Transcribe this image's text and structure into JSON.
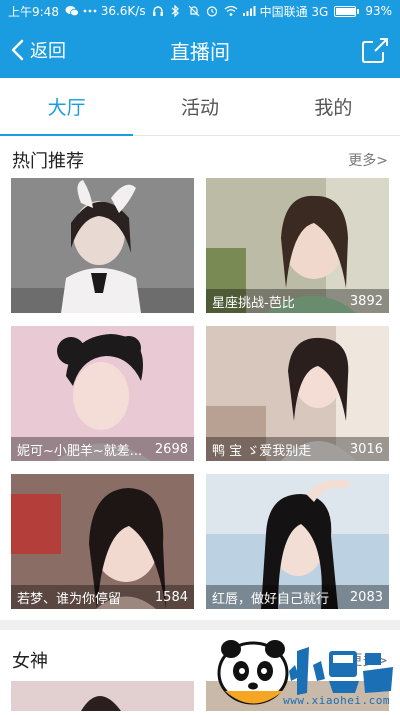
{
  "status": {
    "time": "上午9:48",
    "speed": "36.6K/s",
    "carrier": "中国联通 3G",
    "battery": "93%",
    "battery_fraction": 0.93
  },
  "nav": {
    "back_label": "返回",
    "title": "直播间"
  },
  "tabs": [
    {
      "label": "大厅",
      "active": true
    },
    {
      "label": "活动",
      "active": false
    },
    {
      "label": "我的",
      "active": false
    }
  ],
  "sections": [
    {
      "title": "热门推荐",
      "more": "更多>",
      "cards": [
        {
          "name": "",
          "count": ""
        },
        {
          "name": "星座挑战-芭比",
          "count": "3892"
        },
        {
          "name": "妮可~小肥羊~就差...",
          "count": "2698"
        },
        {
          "name": "鸭 宝 ゞ爱我别走",
          "count": "3016"
        },
        {
          "name": "若梦、谁为你停留",
          "count": "1584"
        },
        {
          "name": "红唇，做好自己就行",
          "count": "2083"
        }
      ]
    },
    {
      "title": "女神",
      "more": "更多>"
    }
  ],
  "watermark": {
    "url": "www.xiaohei.com"
  },
  "colors": {
    "accent": "#1b9be0"
  }
}
